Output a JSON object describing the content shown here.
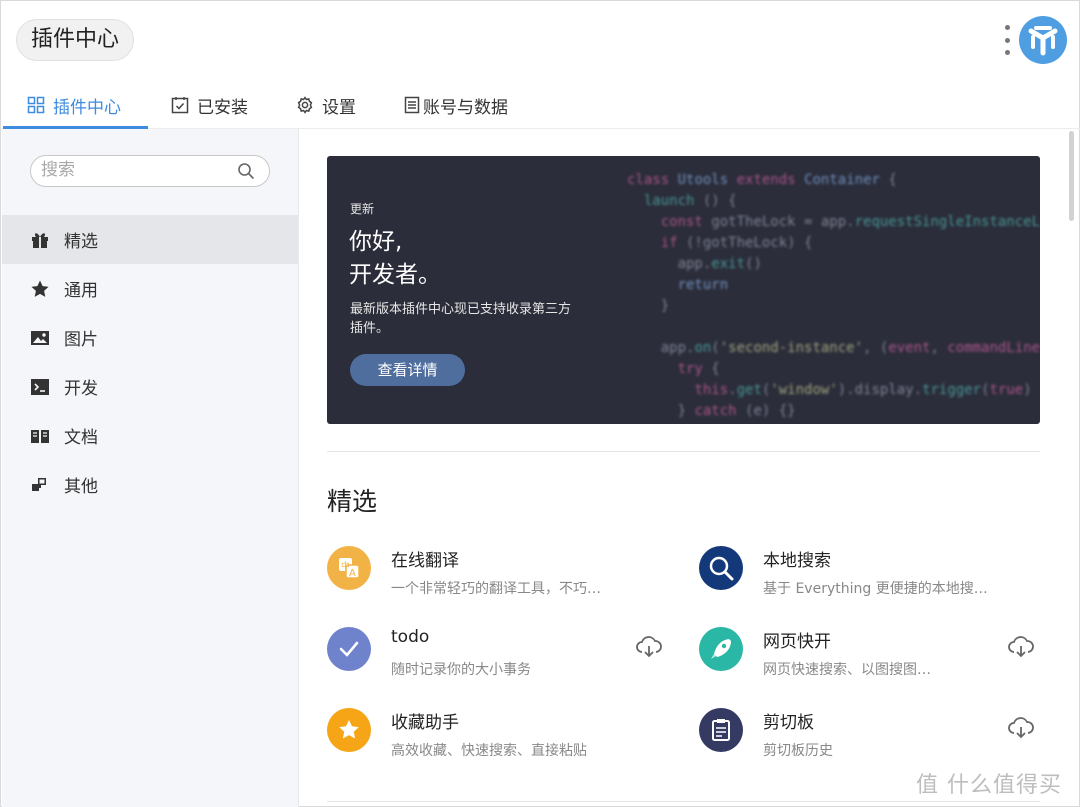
{
  "app": {
    "title": "插件中心"
  },
  "tabs": [
    {
      "label": "插件中心",
      "icon": "grid-icon"
    },
    {
      "label": "已安装",
      "icon": "installed-check-icon"
    },
    {
      "label": "设置",
      "icon": "gear-icon"
    },
    {
      "label": "账号与数据",
      "icon": "account-data-icon"
    }
  ],
  "sidebar": {
    "search_placeholder": "搜索",
    "items": [
      {
        "label": "精选",
        "icon": "gift-icon"
      },
      {
        "label": "通用",
        "icon": "star-icon"
      },
      {
        "label": "图片",
        "icon": "image-icon"
      },
      {
        "label": "开发",
        "icon": "terminal-icon"
      },
      {
        "label": "文档",
        "icon": "book-icon"
      },
      {
        "label": "其他",
        "icon": "blocks-icon"
      }
    ]
  },
  "banner": {
    "tag": "更新",
    "title_line1": "你好,",
    "title_line2": "开发者。",
    "desc": "最新版本插件中心现已支持收录第三方插件。",
    "button": "查看详情"
  },
  "featured": {
    "title": "精选",
    "plugins": [
      {
        "name": "在线翻译",
        "desc": "一个非常轻巧的翻译工具，不巧…",
        "icon": "translate-icon",
        "color": "#f2b346"
      },
      {
        "name": "本地搜索",
        "desc": "基于 Everything 更便捷的本地搜…",
        "icon": "local-search-icon",
        "color": "#13397b"
      },
      {
        "name": "todo",
        "desc": "随时记录你的大小事务",
        "icon": "todo-check-icon",
        "color": "#6f82cc"
      },
      {
        "name": "网页快开",
        "desc": "网页快速搜索、以图搜图…",
        "icon": "rocket-icon",
        "color": "#2bb7a6"
      },
      {
        "name": "收藏助手",
        "desc": "高效收藏、快速搜索、直接粘贴",
        "icon": "favorite-star-icon",
        "color": "#f5a516"
      },
      {
        "name": "剪切板",
        "desc": "剪切板历史",
        "icon": "clipboard-icon",
        "color": "#353a63"
      }
    ]
  },
  "watermark": "值 什么值得买"
}
